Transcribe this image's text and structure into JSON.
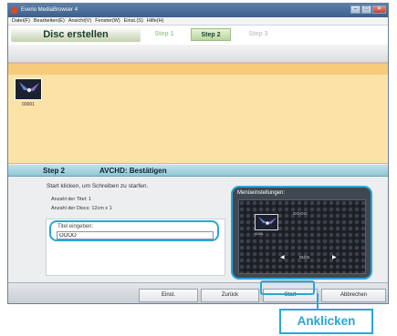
{
  "window": {
    "title": "Everio MediaBrowser 4",
    "controls": {
      "minimize": "‒",
      "maximize": "□",
      "close": "✕"
    }
  },
  "menubar": [
    {
      "label": "Datei(F)"
    },
    {
      "label": "Bearbeiten(E)"
    },
    {
      "label": "Ansicht(V)"
    },
    {
      "label": "Fenster(W)"
    },
    {
      "label": "Einst.(S)"
    },
    {
      "label": "Hilfe(H)"
    }
  ],
  "stepbar": {
    "disc_title": "Disc erstellen",
    "steps": [
      {
        "label": "Step 1",
        "state": "done"
      },
      {
        "label": "Step 2",
        "state": "active"
      },
      {
        "label": "Step 3",
        "state": "pending"
      }
    ]
  },
  "thumbnail": {
    "label": "00001"
  },
  "section": {
    "step": "Step 2",
    "title": "AVCHD: Bestätigen"
  },
  "content": {
    "instruction": "Start klicken, um Schreiben zu starfen.",
    "title_count": "Anzahl der Titel: 1",
    "disc_count": "Anzahl der Discs: 12cm x 1",
    "title_label": "Titel eingeben:",
    "title_value": "OOOO"
  },
  "menu_settings": {
    "label": "Menüeinstellungen:",
    "preview_heading": "OOOO",
    "thumb_caption": "00001",
    "page": "01/01",
    "prev_icon": "triangle-left",
    "next_icon": "triangle-right"
  },
  "buttons": {
    "einst": "Einst.",
    "zurueck": "Zurück",
    "start": "Start",
    "abbrechen": "Abbrechen"
  },
  "callout": {
    "text": "Anklicken"
  },
  "colors": {
    "highlight": "#2aa6d6",
    "thumbnail_area": "#fbe3a8",
    "section_header": "#8fc7d3"
  }
}
